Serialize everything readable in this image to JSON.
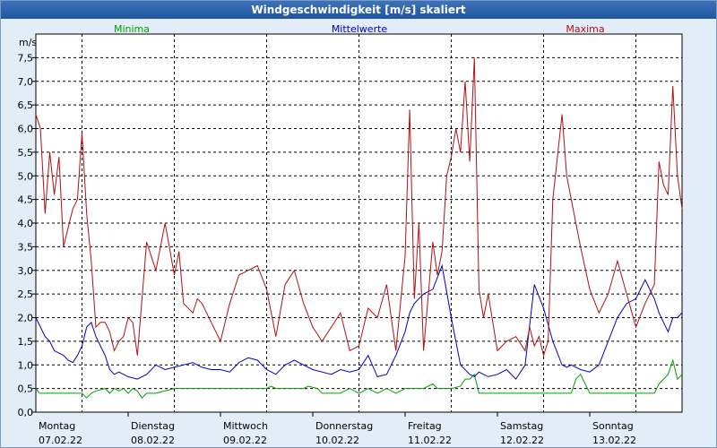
{
  "window_title": "Windgeschwindigkeit [m/s] skaliert",
  "colors": {
    "minima": "#00a000",
    "mittel": "#0000c0",
    "maxima": "#b01010"
  },
  "chart_data": {
    "type": "line",
    "ylabel": "m/s",
    "ylim": [
      0,
      8
    ],
    "yticks": [
      "0,0",
      "0,5",
      "1,0",
      "1,5",
      "2,0",
      "2,5",
      "3,0",
      "3,5",
      "4,0",
      "4,5",
      "5,0",
      "5,5",
      "6,0",
      "6,5",
      "7,0",
      "7,5"
    ],
    "ytick_values": [
      0,
      0.5,
      1,
      1.5,
      2,
      2.5,
      3,
      3.5,
      4,
      4.5,
      5,
      5.5,
      6,
      6.5,
      7,
      7.5
    ],
    "days": [
      {
        "weekday": "Montag",
        "date": "07.02.22"
      },
      {
        "weekday": "Dienstag",
        "date": "08.02.22"
      },
      {
        "weekday": "Mittwoch",
        "date": "09.02.22"
      },
      {
        "weekday": "Donnerstag",
        "date": "10.02.22"
      },
      {
        "weekday": "Freitag",
        "date": "11.02.22"
      },
      {
        "weekday": "Samstag",
        "date": "12.02.22"
      },
      {
        "weekday": "Sonntag",
        "date": "13.02.22"
      }
    ],
    "x_range_days": [
      0,
      7
    ],
    "grid": true,
    "series": [
      {
        "name": "Minima",
        "x": [
          0,
          0.04,
          0.5,
          0.55,
          0.6,
          0.65,
          0.75,
          0.8,
          0.85,
          0.9,
          0.95,
          1.0,
          1.05,
          1.1,
          1.15,
          1.2,
          1.25,
          1.3,
          1.5,
          1.6,
          2.5,
          2.55,
          2.6,
          2.9,
          2.95,
          3.05,
          3.1,
          3.3,
          3.4,
          3.5,
          3.6,
          3.7,
          3.8,
          3.9,
          4.0,
          4.2,
          4.3,
          4.35,
          4.5,
          4.6,
          4.65,
          4.7,
          4.75,
          4.8,
          5.0,
          5.8,
          5.85,
          5.9,
          5.95,
          6.0,
          6.7,
          6.75,
          6.8,
          6.85,
          6.9,
          6.95,
          7.0
        ],
        "values": [
          0.5,
          0.4,
          0.4,
          0.3,
          0.4,
          0.45,
          0.5,
          0.4,
          0.5,
          0.45,
          0.5,
          0.4,
          0.5,
          0.45,
          0.3,
          0.4,
          0.4,
          0.4,
          0.5,
          0.5,
          0.5,
          0.55,
          0.5,
          0.5,
          0.55,
          0.5,
          0.4,
          0.4,
          0.5,
          0.4,
          0.5,
          0.4,
          0.5,
          0.4,
          0.5,
          0.5,
          0.6,
          0.5,
          0.5,
          0.55,
          0.7,
          0.7,
          0.8,
          0.4,
          0.4,
          0.4,
          0.7,
          0.8,
          0.6,
          0.4,
          0.4,
          0.6,
          0.7,
          0.8,
          1.1,
          0.7,
          0.8
        ]
      },
      {
        "name": "Mittelwerte",
        "x": [
          0,
          0.1,
          0.15,
          0.2,
          0.25,
          0.3,
          0.35,
          0.4,
          0.45,
          0.5,
          0.55,
          0.6,
          0.65,
          0.7,
          0.75,
          0.8,
          0.85,
          0.9,
          0.95,
          1.0,
          1.1,
          1.2,
          1.3,
          1.4,
          1.5,
          1.6,
          1.7,
          1.8,
          1.9,
          2.0,
          2.1,
          2.2,
          2.3,
          2.4,
          2.5,
          2.6,
          2.7,
          2.8,
          2.9,
          3.0,
          3.1,
          3.2,
          3.3,
          3.4,
          3.5,
          3.6,
          3.7,
          3.8,
          3.9,
          4.0,
          4.05,
          4.1,
          4.2,
          4.3,
          4.4,
          4.5,
          4.6,
          4.7,
          4.75,
          4.8,
          4.85,
          4.9,
          5.0,
          5.1,
          5.2,
          5.3,
          5.4,
          5.5,
          5.6,
          5.7,
          5.75,
          5.8,
          5.9,
          6.0,
          6.1,
          6.2,
          6.3,
          6.4,
          6.5,
          6.6,
          6.7,
          6.75,
          6.8,
          6.85,
          6.9,
          6.95,
          7.0
        ],
        "values": [
          2.0,
          1.6,
          1.5,
          1.3,
          1.25,
          1.2,
          1.1,
          1.05,
          1.2,
          1.4,
          1.8,
          1.9,
          1.6,
          1.4,
          1.2,
          0.9,
          0.8,
          0.85,
          0.8,
          0.75,
          0.7,
          0.8,
          1.0,
          0.9,
          0.95,
          1.0,
          1.05,
          0.95,
          0.9,
          0.9,
          0.85,
          1.05,
          1.15,
          1.1,
          0.9,
          0.8,
          1.0,
          1.1,
          1.0,
          0.9,
          0.85,
          0.8,
          0.9,
          0.85,
          0.9,
          1.2,
          0.75,
          0.8,
          1.2,
          1.7,
          2.1,
          2.3,
          2.5,
          2.6,
          3.1,
          2.0,
          1.0,
          0.8,
          0.75,
          0.85,
          0.8,
          0.75,
          0.8,
          0.9,
          0.7,
          1.0,
          2.7,
          2.2,
          1.5,
          1.0,
          0.95,
          1.0,
          0.9,
          0.85,
          1.0,
          1.5,
          2.0,
          2.3,
          2.4,
          2.8,
          2.4,
          2.1,
          1.9,
          1.7,
          2.0,
          2.0,
          2.1
        ]
      },
      {
        "name": "Maxima",
        "x": [
          0,
          0.05,
          0.1,
          0.15,
          0.2,
          0.25,
          0.3,
          0.35,
          0.4,
          0.45,
          0.5,
          0.55,
          0.6,
          0.65,
          0.7,
          0.75,
          0.8,
          0.85,
          0.9,
          0.95,
          1.0,
          1.05,
          1.1,
          1.2,
          1.3,
          1.4,
          1.5,
          1.55,
          1.6,
          1.7,
          1.75,
          1.8,
          1.9,
          2.0,
          2.1,
          2.2,
          2.3,
          2.4,
          2.5,
          2.6,
          2.7,
          2.8,
          2.9,
          3.0,
          3.1,
          3.2,
          3.3,
          3.4,
          3.5,
          3.6,
          3.7,
          3.8,
          3.9,
          4.0,
          4.05,
          4.1,
          4.15,
          4.2,
          4.3,
          4.35,
          4.4,
          4.45,
          4.5,
          4.55,
          4.6,
          4.65,
          4.7,
          4.75,
          4.8,
          4.85,
          4.9,
          5.0,
          5.1,
          5.2,
          5.3,
          5.35,
          5.4,
          5.45,
          5.5,
          5.55,
          5.6,
          5.7,
          5.75,
          5.8,
          5.9,
          6.0,
          6.1,
          6.2,
          6.3,
          6.4,
          6.5,
          6.6,
          6.7,
          6.75,
          6.8,
          6.85,
          6.9,
          6.95,
          7.0
        ],
        "values": [
          6.3,
          6.0,
          4.2,
          5.5,
          4.6,
          5.4,
          3.5,
          3.9,
          4.3,
          4.5,
          5.9,
          4.2,
          3.2,
          1.8,
          1.9,
          1.9,
          1.7,
          1.3,
          1.5,
          1.6,
          2.0,
          1.9,
          1.2,
          3.6,
          3.0,
          4.0,
          2.9,
          3.4,
          2.3,
          2.1,
          2.4,
          2.3,
          1.9,
          1.5,
          2.3,
          2.9,
          3.0,
          3.1,
          2.6,
          1.6,
          2.7,
          3.0,
          2.3,
          1.8,
          1.5,
          1.8,
          2.1,
          1.3,
          1.4,
          2.2,
          2.0,
          2.7,
          1.3,
          3.3,
          6.4,
          2.4,
          4.0,
          1.3,
          3.6,
          2.9,
          3.4,
          5.0,
          5.4,
          6.0,
          5.5,
          7.0,
          5.3,
          7.5,
          2.6,
          2.0,
          2.5,
          1.3,
          1.5,
          1.6,
          1.3,
          1.8,
          1.4,
          1.6,
          1.2,
          1.5,
          4.5,
          6.3,
          5.0,
          4.5,
          3.5,
          2.6,
          2.1,
          2.5,
          3.2,
          2.5,
          1.8,
          2.3,
          2.7,
          5.3,
          4.8,
          4.6,
          6.9,
          5.0,
          4.3
        ]
      }
    ]
  }
}
